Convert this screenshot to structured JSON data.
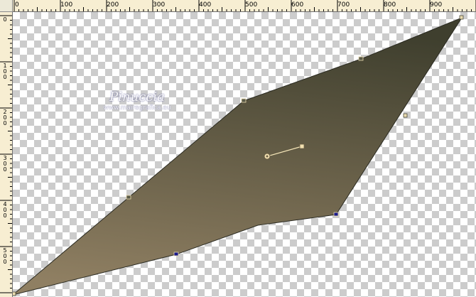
{
  "ruler": {
    "top_labels": [
      "0",
      "100",
      "200",
      "300",
      "400",
      "500",
      "600",
      "700",
      "800",
      "900"
    ],
    "left_labels": [
      "0",
      "100",
      "200",
      "300",
      "400",
      "500"
    ]
  },
  "watermark": {
    "title": "Pinuccia",
    "subtitle": "www.mairegrafica.eu"
  },
  "shape": {
    "gradient_colors": [
      "#3f3f2e",
      "#8f7f62"
    ],
    "outline_color": "#2b2b22",
    "node_color": "#1a1a8a"
  }
}
